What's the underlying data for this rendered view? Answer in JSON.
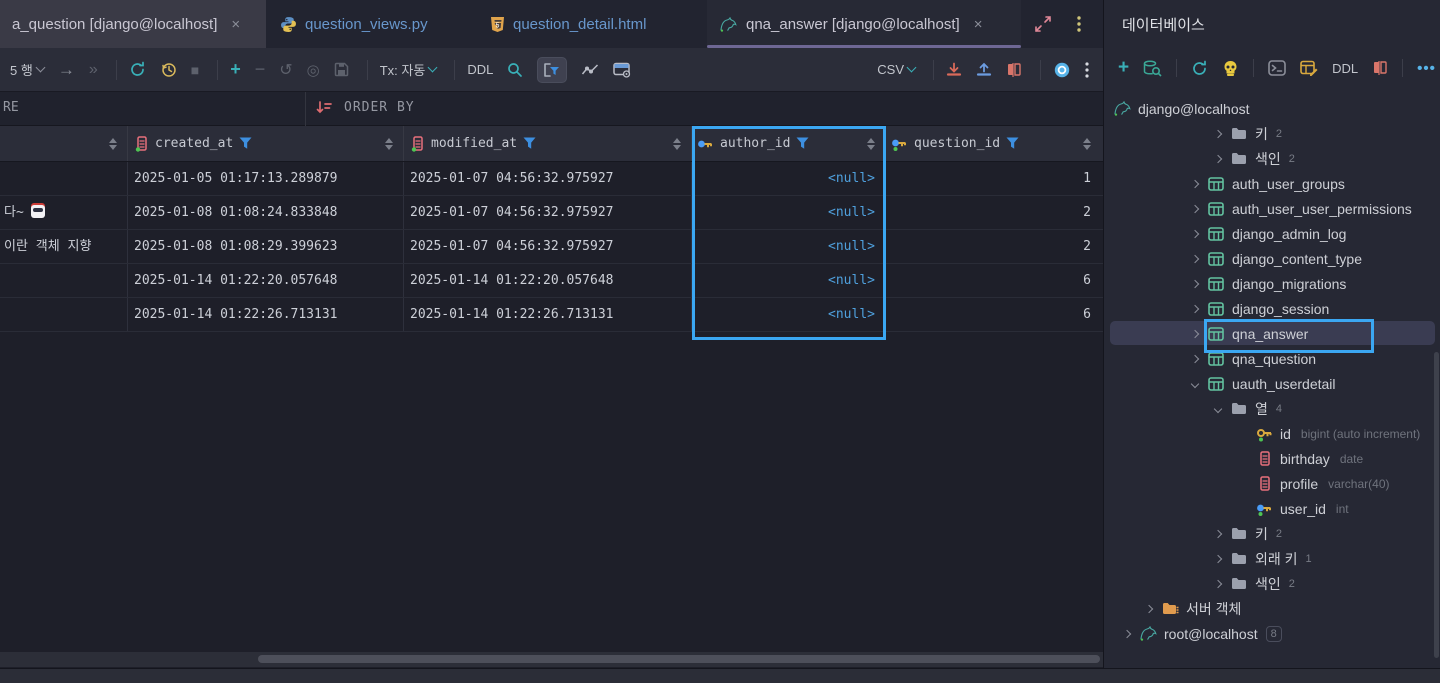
{
  "tabs": [
    {
      "label": "a_question [django@localhost]",
      "icon": null,
      "close": "×"
    },
    {
      "label": "question_views.py",
      "icon": "python-icon"
    },
    {
      "label": "question_detail.html",
      "icon": "html5-icon"
    },
    {
      "label": "qna_answer [django@localhost]",
      "icon": "mysql-icon",
      "close": "×"
    }
  ],
  "editor_toolbar": {
    "page_size_label": "5 행",
    "tx_label": "Tx: 자동",
    "ddl_label": "DDL",
    "export_format": "CSV"
  },
  "filter_bar": {
    "where_label": "RE",
    "order_by_label": "ORDER BY"
  },
  "grid": {
    "columns": [
      {
        "name": "",
        "icon": null
      },
      {
        "name": "created_at",
        "icon": "column-icon"
      },
      {
        "name": "modified_at",
        "icon": "column-icon"
      },
      {
        "name": "author_id",
        "icon": "foreign-key-icon"
      },
      {
        "name": "question_id",
        "icon": "foreign-key-icon"
      }
    ],
    "rows": [
      {
        "text": "",
        "emoji": null,
        "created_at": "2025-01-05 01:17:13.289879",
        "modified_at": "2025-01-07 04:56:32.975927",
        "author_id": "<null>",
        "question_id": "1"
      },
      {
        "text": "다~",
        "emoji": "robot",
        "created_at": "2025-01-08 01:08:24.833848",
        "modified_at": "2025-01-07 04:56:32.975927",
        "author_id": "<null>",
        "question_id": "2"
      },
      {
        "text": "이란 객체 지향",
        "emoji": null,
        "created_at": "2025-01-08 01:08:29.399623",
        "modified_at": "2025-01-07 04:56:32.975927",
        "author_id": "<null>",
        "question_id": "2"
      },
      {
        "text": "",
        "emoji": null,
        "created_at": "2025-01-14 01:22:20.057648",
        "modified_at": "2025-01-14 01:22:20.057648",
        "author_id": "<null>",
        "question_id": "6"
      },
      {
        "text": "",
        "emoji": null,
        "created_at": "2025-01-14 01:22:26.713131",
        "modified_at": "2025-01-14 01:22:26.713131",
        "author_id": "<null>",
        "question_id": "6"
      }
    ]
  },
  "database_panel": {
    "title": "데이터베이스",
    "ddl_label": "DDL",
    "tree": [
      {
        "label": "django@localhost",
        "icon": "mysql-icon",
        "level": "conn",
        "chevron": null,
        "badge": ""
      },
      {
        "label": "키",
        "icon": "folder-icon",
        "level": "folder",
        "chevron": "right",
        "badge": "2"
      },
      {
        "label": "색인",
        "icon": "folder-icon",
        "level": "folder",
        "chevron": "right",
        "badge": "2"
      },
      {
        "label": "auth_user_groups",
        "icon": "table-icon",
        "level": "table",
        "chevron": "right",
        "badge": ""
      },
      {
        "label": "auth_user_user_permissions",
        "icon": "table-icon",
        "level": "table",
        "chevron": "right",
        "badge": ""
      },
      {
        "label": "django_admin_log",
        "icon": "table-icon",
        "level": "table",
        "chevron": "right",
        "badge": ""
      },
      {
        "label": "django_content_type",
        "icon": "table-icon",
        "level": "table",
        "chevron": "right",
        "badge": ""
      },
      {
        "label": "django_migrations",
        "icon": "table-icon",
        "level": "table",
        "chevron": "right",
        "badge": ""
      },
      {
        "label": "django_session",
        "icon": "table-icon",
        "level": "table",
        "chevron": "right",
        "badge": ""
      },
      {
        "label": "qna_answer",
        "icon": "table-icon",
        "level": "table",
        "chevron": "right",
        "badge": "",
        "selected": true
      },
      {
        "label": "qna_question",
        "icon": "table-icon",
        "level": "table",
        "chevron": "right",
        "badge": ""
      },
      {
        "label": "uauth_userdetail",
        "icon": "table-icon",
        "level": "table",
        "chevron": "down",
        "badge": ""
      },
      {
        "label": "열",
        "icon": "folder-icon",
        "level": "folder",
        "chevron": "down",
        "badge": "4"
      },
      {
        "label": "id",
        "icon": "primary-key-icon",
        "level": "column",
        "chevron": null,
        "badge": "",
        "type_hint": "bigint (auto increment)"
      },
      {
        "label": "birthday",
        "icon": "column-icon",
        "level": "column",
        "chevron": null,
        "badge": "",
        "type_hint": "date"
      },
      {
        "label": "profile",
        "icon": "column-icon",
        "level": "column",
        "chevron": null,
        "badge": "",
        "type_hint": "varchar(40)"
      },
      {
        "label": "user_id",
        "icon": "foreign-key-icon",
        "level": "column",
        "chevron": null,
        "badge": "",
        "type_hint": "int"
      },
      {
        "label": "키",
        "icon": "folder-icon",
        "level": "folder",
        "chevron": "right",
        "badge": "2"
      },
      {
        "label": "외래 키",
        "icon": "folder-icon",
        "level": "folder",
        "chevron": "right",
        "badge": "1"
      },
      {
        "label": "색인",
        "icon": "folder-icon",
        "level": "folder",
        "chevron": "right",
        "badge": "2"
      },
      {
        "label": "서버 객체",
        "icon": "server-objects-icon",
        "level": "server",
        "chevron": "right",
        "badge": ""
      },
      {
        "label": "root@localhost",
        "icon": "mysql-icon",
        "level": "conn2",
        "chevron": "right",
        "badge": "8",
        "badge_boxed": true
      }
    ]
  }
}
